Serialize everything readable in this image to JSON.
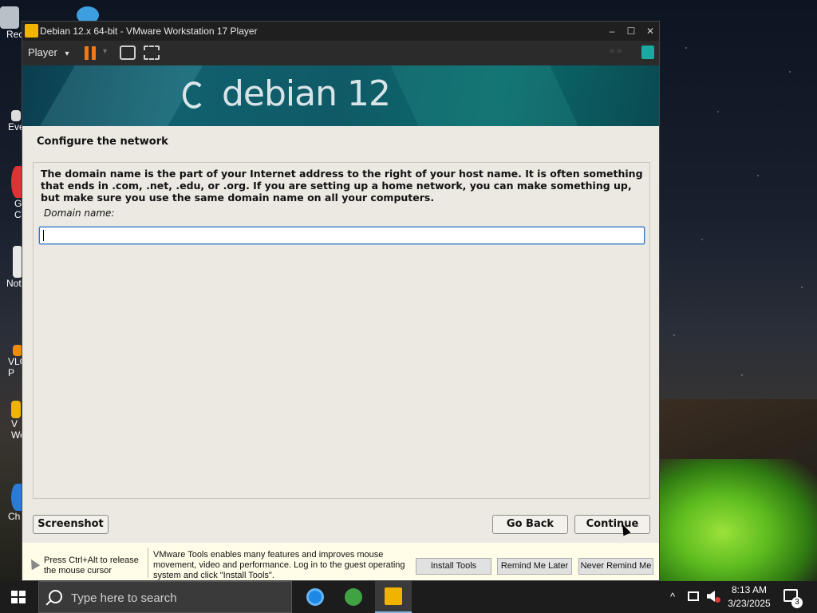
{
  "desktop": {
    "icons": [
      {
        "label": "Rec"
      },
      {
        "label": "Eve"
      },
      {
        "label": "G\nC"
      },
      {
        "label": "Not"
      },
      {
        "label": "VLC\nP"
      },
      {
        "label": "V\nWo"
      },
      {
        "label": "Ch"
      }
    ]
  },
  "window": {
    "title": "Debian 12.x 64-bit - VMware Workstation 17 Player",
    "controls": {
      "minimize": "–",
      "maximize": "☐",
      "close": "✕"
    }
  },
  "toolbar": {
    "player_label": "Player",
    "player_caret": "▾",
    "pause_caret": "▾",
    "arrows": "« »"
  },
  "installer": {
    "brand": "debian 12",
    "page_title": "Configure the network",
    "description": "The domain name is the part of your Internet address to the right of your host name.  It is often something that ends in .com, .net, .edu, or .org.  If you are setting up a home network, you can make something up, but make sure you use the same domain name on all your computers.",
    "field_label": "Domain name:",
    "field_value": "",
    "buttons": {
      "screenshot": "Screenshot",
      "go_back": "Go Back",
      "continue": "Continue"
    }
  },
  "tools_notice": {
    "release_hint": "Press Ctrl+Alt to release the mouse cursor",
    "message": "VMware Tools enables many features and improves mouse movement, video and performance. Log in to the guest operating system and click \"Install Tools\".",
    "install": "Install Tools",
    "remind_later": "Remind Me Later",
    "never_remind": "Never Remind Me"
  },
  "taskbar": {
    "search_placeholder": "Type here to search",
    "tray_chevron": "^",
    "time": "8:13 AM",
    "date": "3/23/2025",
    "notification_count": "3"
  },
  "colors": {
    "accent_orange": "#f07a1a",
    "banner_teal": "#11606f",
    "focus_blue": "#3d78b5",
    "notice_bg": "#fffde7"
  }
}
